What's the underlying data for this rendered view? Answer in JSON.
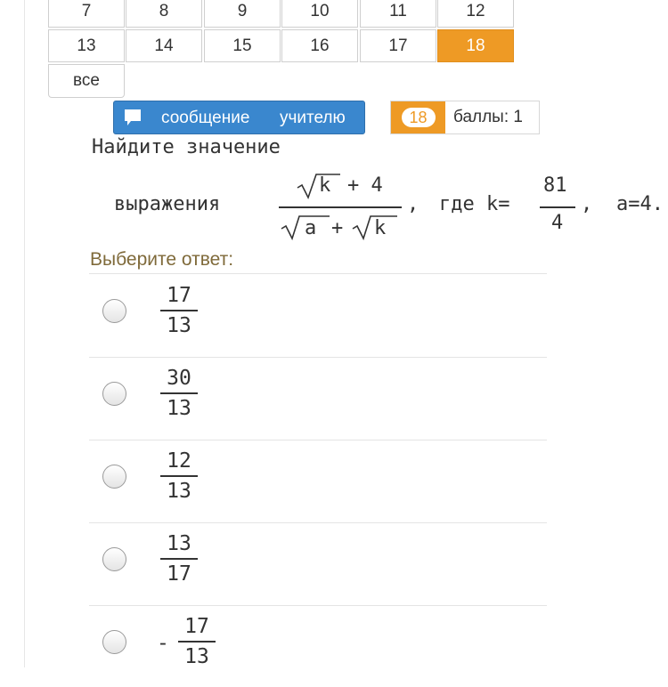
{
  "grid": {
    "rows": [
      [
        "7",
        "8",
        "9",
        "10",
        "11",
        "12"
      ],
      [
        "13",
        "14",
        "15",
        "16",
        "17",
        "18"
      ]
    ],
    "all_label": "все",
    "active": "18"
  },
  "toolbar": {
    "message_word1": "сообщение",
    "message_word2": "учителю",
    "score_number": "18",
    "score_label": "баллы: 1"
  },
  "question": {
    "title": "Найдите значение",
    "expr_word": "выражения",
    "numerator_k": "k",
    "numerator_rest": "+ 4",
    "denominator_a": "a",
    "denominator_plus": "+",
    "denominator_k": "k",
    "sep": ",",
    "where": "где k=",
    "k_num": "81",
    "k_den": "4",
    "a_value": "a=4."
  },
  "prompt": "Выберите ответ:",
  "options": [
    {
      "sign": "",
      "num": "17",
      "den": "13"
    },
    {
      "sign": "",
      "num": "30",
      "den": "13"
    },
    {
      "sign": "",
      "num": "12",
      "den": "13"
    },
    {
      "sign": "",
      "num": "13",
      "den": "17"
    },
    {
      "sign": "-",
      "num": "17",
      "den": "13"
    }
  ],
  "colors": {
    "accent": "#ee9a25",
    "button": "#3a87ce",
    "prompt": "#7f6a3a"
  },
  "icons": {
    "message": "chat-bubble-icon"
  }
}
